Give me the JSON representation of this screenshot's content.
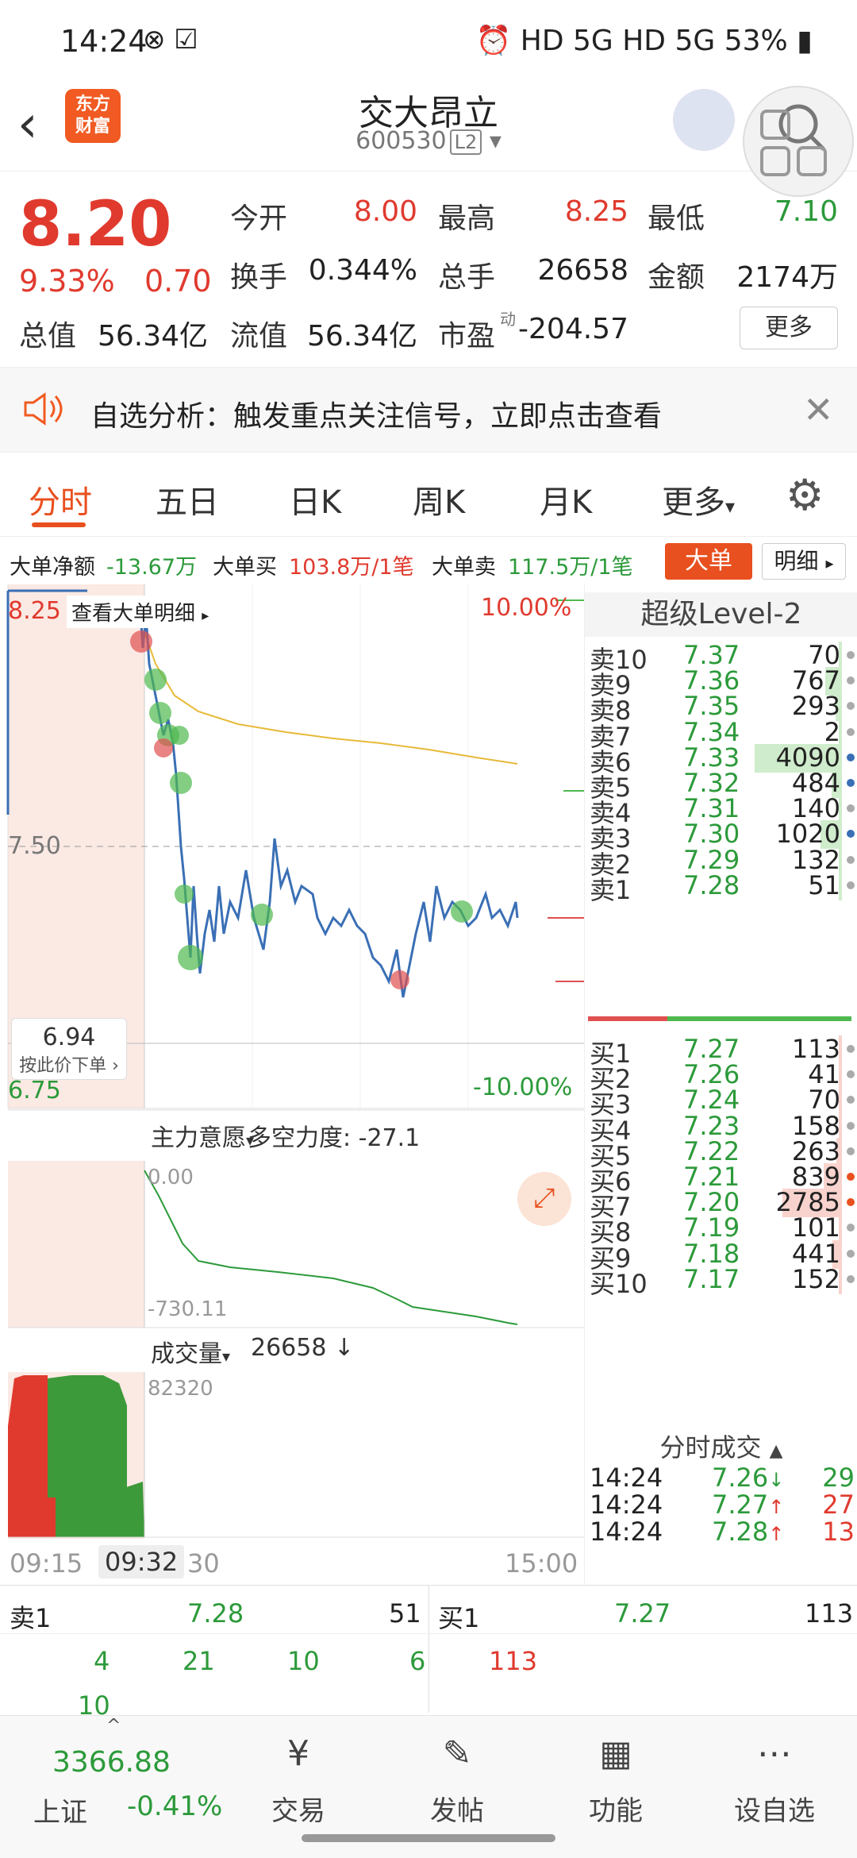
{
  "status": {
    "time": "14:24",
    "right": "HD 5G HD 5G 53%"
  },
  "header": {
    "back": "‹",
    "logo_line1": "东方",
    "logo_line2": "财富",
    "name": "交大昂立",
    "code": "600530",
    "level": "L2"
  },
  "quote": {
    "price": "8.20",
    "chg_pct": "9.33%",
    "chg_amt": "0.70",
    "rows": [
      [
        {
          "label": "今开",
          "value": "8.00",
          "color": "red"
        },
        {
          "label": "最高",
          "value": "8.25",
          "color": "red"
        },
        {
          "label": "最低",
          "value": "7.10",
          "color": "green"
        }
      ],
      [
        {
          "label": "换手",
          "value": "0.344%",
          "color": "black"
        },
        {
          "label": "总手",
          "value": "26658",
          "color": "black"
        },
        {
          "label": "金额",
          "value": "2174万",
          "color": "black"
        }
      ],
      [
        {
          "label": "总值",
          "value": "56.34亿",
          "color": "black"
        },
        {
          "label": "流值",
          "value": "56.34亿",
          "color": "black"
        },
        {
          "label": "市盈",
          "value": "-204.57",
          "color": "black"
        }
      ]
    ],
    "pe_sup": "动",
    "more": "更多"
  },
  "alert": {
    "text": "自选分析：触发重点关注信号，立即点击查看",
    "close": "✕"
  },
  "tabs": [
    "分时",
    "五日",
    "日K",
    "周K",
    "月K",
    "更多"
  ],
  "bigorder": {
    "net_label": "大单净额",
    "net_value": "-13.67万",
    "buy_label": "大单买",
    "buy_value": "103.8万/1笔",
    "sell_label": "大单卖",
    "sell_value": "117.5万/1笔",
    "btn": "大单",
    "detail": "明细"
  },
  "chart": {
    "top_left": "8.25",
    "view_big": "查看大单明细",
    "top_right": "10.00%",
    "mid_price": "7.50",
    "cursor_price": "6.94",
    "cursor_hint": "按此价下单",
    "bottom_left": "6.75",
    "bottom_right": "-10.00%",
    "sub1_label": "主力意愿",
    "sub1_value": "多空力度: -27.1",
    "sub1_top": "0.00",
    "sub1_bottom": "-730.11",
    "sub2_label": "成交量",
    "sub2_value": "26658",
    "sub2_top": "82320",
    "t_start": "09:15",
    "t_cursor": "09:32",
    "t_mid": "30",
    "t_end": "15:00"
  },
  "level2": {
    "title": "超级Level-2",
    "asks": [
      {
        "label": "卖10",
        "price": "7.37",
        "vol": "70"
      },
      {
        "label": "卖9",
        "price": "7.36",
        "vol": "767"
      },
      {
        "label": "卖8",
        "price": "7.35",
        "vol": "293"
      },
      {
        "label": "卖7",
        "price": "7.34",
        "vol": "2"
      },
      {
        "label": "卖6",
        "price": "7.33",
        "vol": "4090"
      },
      {
        "label": "卖5",
        "price": "7.32",
        "vol": "484"
      },
      {
        "label": "卖4",
        "price": "7.31",
        "vol": "140"
      },
      {
        "label": "卖3",
        "price": "7.30",
        "vol": "1020"
      },
      {
        "label": "卖2",
        "price": "7.29",
        "vol": "132"
      },
      {
        "label": "卖1",
        "price": "7.28",
        "vol": "51"
      }
    ],
    "bids": [
      {
        "label": "买1",
        "price": "7.27",
        "vol": "113"
      },
      {
        "label": "买2",
        "price": "7.26",
        "vol": "41"
      },
      {
        "label": "买3",
        "price": "7.24",
        "vol": "70"
      },
      {
        "label": "买4",
        "price": "7.23",
        "vol": "158"
      },
      {
        "label": "买5",
        "price": "7.22",
        "vol": "263"
      },
      {
        "label": "买6",
        "price": "7.21",
        "vol": "839"
      },
      {
        "label": "买7",
        "price": "7.20",
        "vol": "2785"
      },
      {
        "label": "买8",
        "price": "7.19",
        "vol": "101"
      },
      {
        "label": "买9",
        "price": "7.18",
        "vol": "441"
      },
      {
        "label": "买10",
        "price": "7.17",
        "vol": "152"
      }
    ],
    "tick_title": "分时成交",
    "ticks": [
      {
        "time": "14:24",
        "price": "7.26",
        "arrow": "↓",
        "vol": "29"
      },
      {
        "time": "14:24",
        "price": "7.27",
        "arrow": "↑",
        "vol": "27"
      },
      {
        "time": "14:24",
        "price": "7.28",
        "arrow": "↑",
        "vol": "13"
      }
    ]
  },
  "l1": {
    "sell_label": "卖1",
    "sell_price": "7.28",
    "sell_vol": "51",
    "buy_label": "买1",
    "buy_price": "7.27",
    "buy_vol": "113",
    "sell_queue": [
      "4",
      "21",
      "10",
      "6",
      "10"
    ],
    "buy_queue": [
      "113"
    ]
  },
  "nav": {
    "index_value": "3366.88",
    "index_name": "上证",
    "index_chg": "-0.41%",
    "items": [
      "交易",
      "发帖",
      "功能",
      "设自选"
    ]
  },
  "colors": {
    "up": "#e03a2e",
    "down": "#2c9a3a",
    "accent": "#e8501f"
  }
}
